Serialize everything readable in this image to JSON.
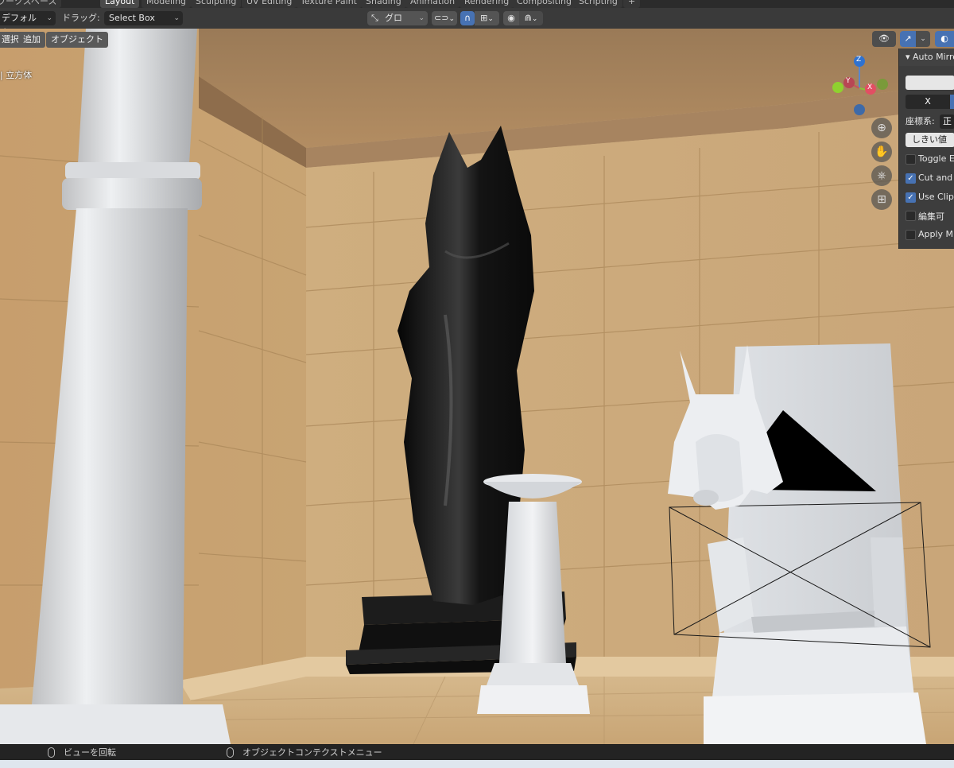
{
  "workspace_tabs": [
    "ワークスペース",
    "Layout",
    "Modeling",
    "Sculpting",
    "UV Editing",
    "Texture Paint",
    "Shading",
    "Animation",
    "Rendering",
    "Compositing",
    "Scripting",
    "+"
  ],
  "header": {
    "mode_dropdown": "デフォルト",
    "drag_label": "ドラッグ:",
    "select_box": "Select Box",
    "transform_orientation": "グロー...",
    "pivot_icon": "link-icon",
    "snap_icon": "magnet-icon",
    "proportional_icon": "circle-icon"
  },
  "viewport": {
    "menu": [
      "選択",
      "追加",
      "オブジェクト"
    ],
    "object_name": "| 立方体",
    "gizmo_axes": [
      "Z",
      "Y",
      "X"
    ],
    "nav_icons": [
      "zoom-icon",
      "hand-icon",
      "camera-icon",
      "grid-icon"
    ]
  },
  "panel": {
    "title": "Auto Mirror",
    "axis_button": "X",
    "orientation_label": "座標系:",
    "orientation_value": "正",
    "threshold_button": "しきい値",
    "options": [
      {
        "label": "Toggle Edit",
        "checked": false
      },
      {
        "label": "Cut and Mirror",
        "checked": true
      },
      {
        "label": "Use Clip",
        "checked": true
      },
      {
        "label": "編集可",
        "checked": false
      },
      {
        "label": "Apply Mirror",
        "checked": false
      }
    ]
  },
  "status": {
    "left": "ビューを回転",
    "right": "オブジェクトコンテクストメニュー"
  },
  "colors": {
    "accent": "#4772b3",
    "header_bg": "#3a3a3a",
    "panel_bg": "#3d3d3d"
  }
}
